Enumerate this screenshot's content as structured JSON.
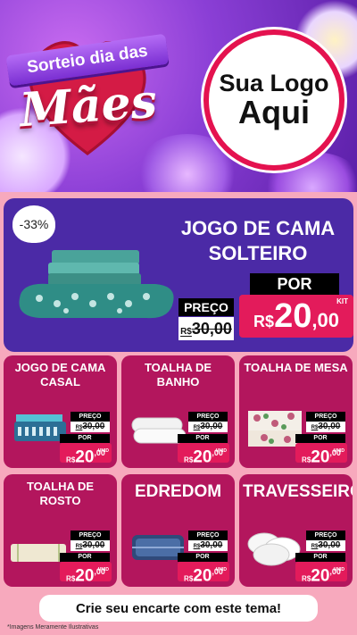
{
  "header": {
    "ribbon_text": "Sorteio dia das",
    "title_word": "Mães",
    "logo_line1": "Sua Logo",
    "logo_line2": "Aqui"
  },
  "featured": {
    "discount": "-33%",
    "title": "JOGO DE CAMA SOLTEIRO",
    "price_label": "PREÇO",
    "old_currency": "R$",
    "old_price": "30,00",
    "por_label": "POR",
    "new_currency": "R$",
    "new_price_int": "20",
    "new_price_dec": ",00",
    "kit_label": "KIT"
  },
  "cards": [
    {
      "title": "JOGO DE CAMA CASAL",
      "preco": "PREÇO",
      "old": "30,00",
      "old_cur": "R$",
      "por": "POR",
      "cur": "R$",
      "int": "20",
      "dec": ",00",
      "kit": "UNID"
    },
    {
      "title": "TOALHA DE BANHO",
      "preco": "PREÇO",
      "old": "30,00",
      "old_cur": "R$",
      "por": "POR",
      "cur": "R$",
      "int": "20",
      "dec": ",00",
      "kit": "UNID"
    },
    {
      "title": "TOALHA DE MESA",
      "preco": "PREÇO",
      "old": "30,00",
      "old_cur": "R$",
      "por": "POR",
      "cur": "R$",
      "int": "20",
      "dec": ",00",
      "kit": "UNID"
    },
    {
      "title": "TOALHA DE ROSTO",
      "preco": "PREÇO",
      "old": "30,00",
      "old_cur": "R$",
      "por": "POR",
      "cur": "R$",
      "int": "20",
      "dec": ",00",
      "kit": "UNID"
    },
    {
      "title": "EDREDOM",
      "preco": "PREÇO",
      "old": "30,00",
      "old_cur": "R$",
      "por": "POR",
      "cur": "R$",
      "int": "20",
      "dec": ",00",
      "kit": "UNID"
    },
    {
      "title": "TRAVESSEIRO",
      "preco": "PREÇO",
      "old": "30,00",
      "old_cur": "R$",
      "por": "POR",
      "cur": "R$",
      "int": "20",
      "dec": ",00",
      "kit": "UNID"
    }
  ],
  "cta": "Crie seu encarte com este tema!",
  "footnote": "*Imagens Meramente Ilustrativas",
  "colors": {
    "header_purple": "#8b3fd6",
    "featured_bg": "#4b2aa6",
    "card_bg": "#b3165d",
    "accent_pink": "#e31b5b",
    "page_bg": "#f7a9bd"
  }
}
